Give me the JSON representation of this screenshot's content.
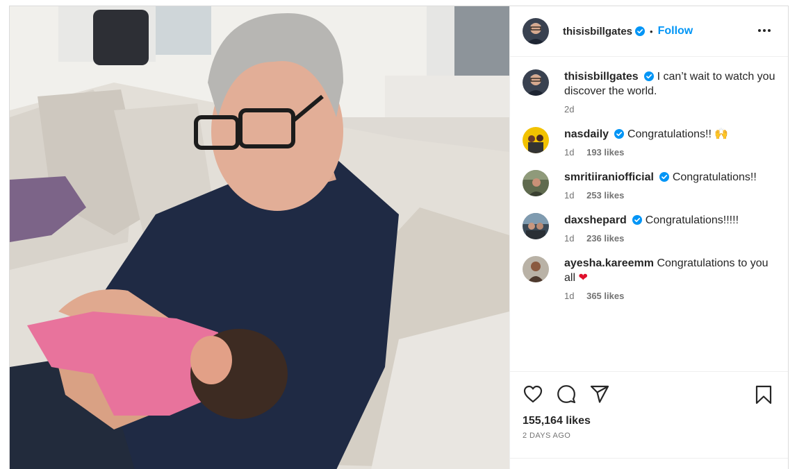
{
  "post": {
    "author": "thisisbillgates",
    "follow_label": "Follow",
    "separator": "•",
    "caption": {
      "username": "thisisbillgates",
      "text": "I can’t wait to watch you discover the world.",
      "time": "2d"
    },
    "comments": [
      {
        "username": "nasdaily",
        "verified": true,
        "text": "Congratulations!! 🙌",
        "time": "1d",
        "likes": "193 likes"
      },
      {
        "username": "smritiiraniofficial",
        "verified": true,
        "text": "Congratulations!!",
        "time": "1d",
        "likes": "253 likes"
      },
      {
        "username": "daxshepard",
        "verified": true,
        "text": "Congratulations!!!!!",
        "time": "1d",
        "likes": "236 likes"
      },
      {
        "username": "ayesha.kareemm",
        "verified": false,
        "text": "Congratulations to you all",
        "heart": "❤",
        "time": "1d",
        "likes": "365 likes"
      }
    ],
    "like_count": "155,164 likes",
    "posted": "2 DAYS AGO"
  },
  "icons": {
    "like": "heart-icon",
    "comment": "comment-icon",
    "share": "share-icon",
    "save": "bookmark-icon",
    "more": "more-options-icon",
    "verified": "verified-badge-icon"
  },
  "colors": {
    "follow": "#0095f6",
    "verified": "#0095f6",
    "text": "#262626",
    "secondary": "#737373",
    "heart": "#e0102c"
  }
}
